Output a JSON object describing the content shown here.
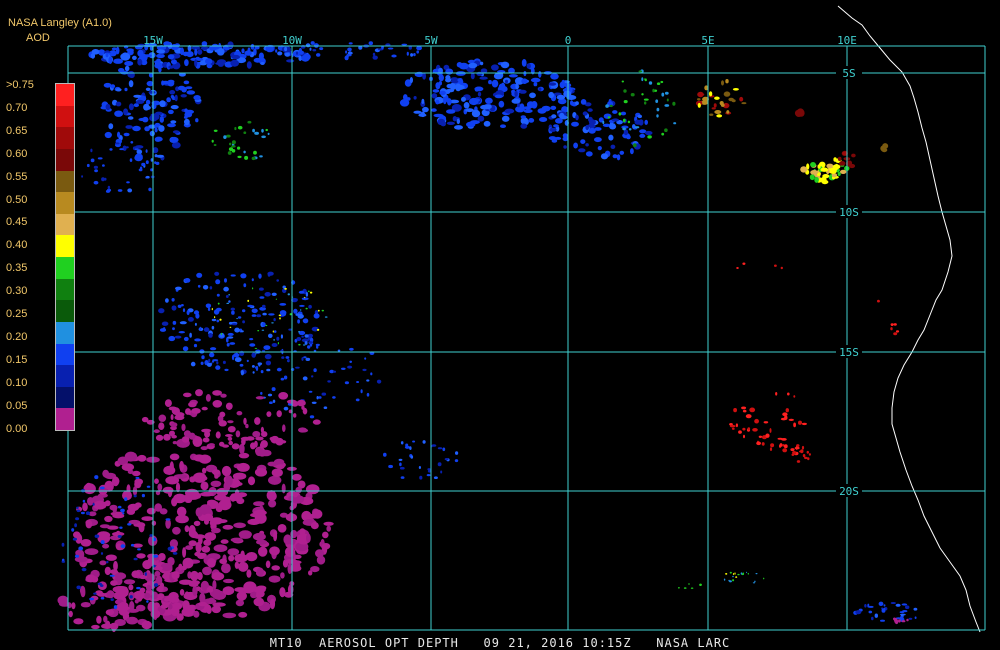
{
  "header": {
    "source": "NASA Langley (A1.0)",
    "variable": "AOD"
  },
  "legend": {
    "labels": [
      ">0.75",
      "0.70",
      "0.65",
      "0.60",
      "0.55",
      "0.50",
      "0.45",
      "0.40",
      "0.35",
      "0.30",
      "0.25",
      "0.20",
      "0.15",
      "0.10",
      "0.05",
      "0.00"
    ],
    "colors": [
      "#ff2020",
      "#d01010",
      "#a00a0a",
      "#7a0808",
      "#7a5a10",
      "#b88a20",
      "#e0b050",
      "#ffff00",
      "#20d020",
      "#108010",
      "#0a5a0a",
      "#2090e0",
      "#1040f0",
      "#0820b0",
      "#04106a",
      "#b02090"
    ]
  },
  "map": {
    "longitude_labels": [
      "15W",
      "10W",
      "5W",
      "0",
      "5E",
      "10E"
    ],
    "latitude_labels": [
      "5S",
      "10S",
      "15S",
      "20S"
    ],
    "grid_color": "#40d0d0",
    "coast_color": "#ffffff"
  },
  "footer": {
    "text": "MT10  AEROSOL OPT DEPTH   09 21, 2016 10:15Z   NASA LARC"
  }
}
